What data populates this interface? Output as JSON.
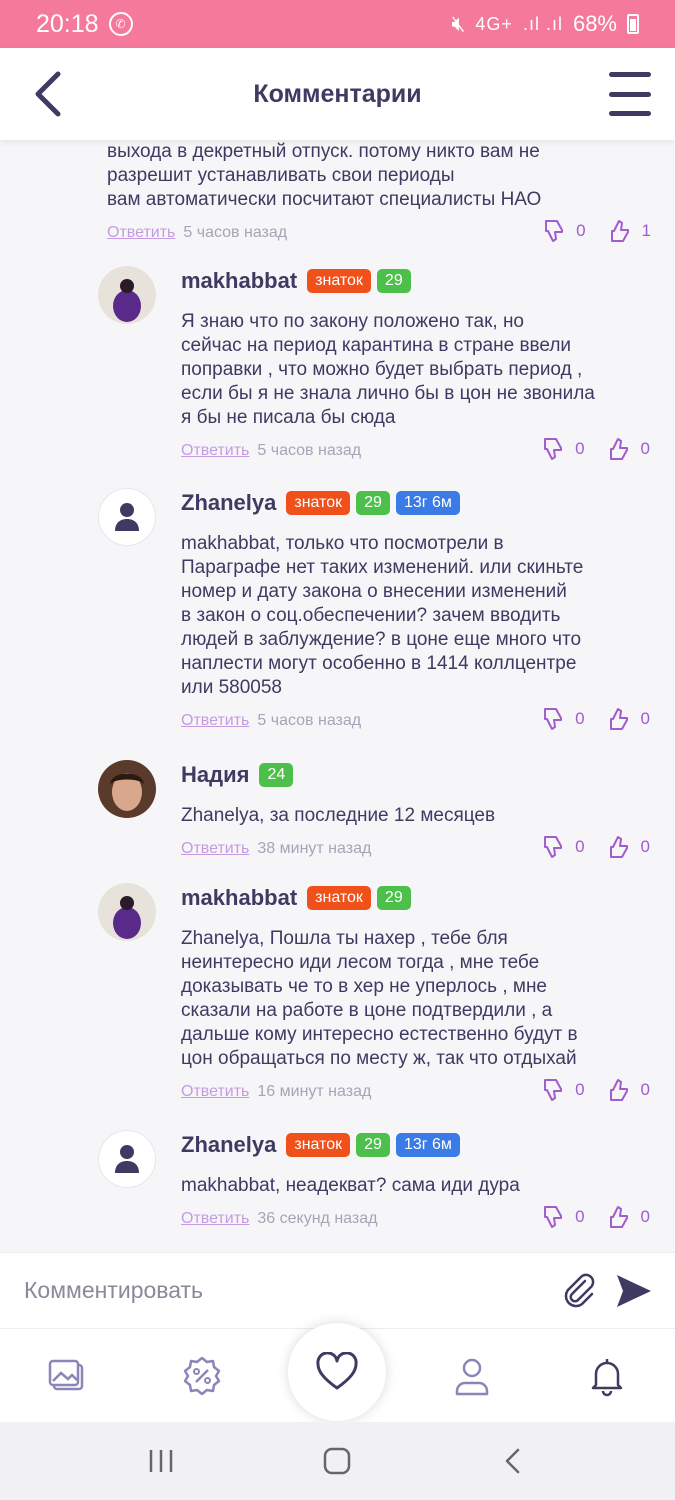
{
  "status_bar": {
    "time": "20:18",
    "network": "4G+",
    "battery": "68%"
  },
  "header": {
    "title": "Комментарии"
  },
  "top_comment": {
    "text": "выхода в декретный отпуск. потому никто вам не\nразрешит устанавливать свои периоды\n вам автоматически посчитают специалисты НАО",
    "reply": "Ответить",
    "time": "5 часов назад",
    "dislikes": "0",
    "likes": "1"
  },
  "comments": [
    {
      "name": "makhabbat",
      "badges": [
        "знаток",
        "29"
      ],
      "text": "Я знаю что по закону положено так, но\nсейчас на период карантина в стране ввели\nпоправки , что можно будет выбрать период ,\nесли бы я не знала лично бы в цон не звонила\nя бы не писала бы сюда",
      "reply": "Ответить",
      "time": "5 часов назад",
      "dislikes": "0",
      "likes": "0"
    },
    {
      "name": "Zhanelya",
      "badges": [
        "знаток",
        "29",
        "13г 6м"
      ],
      "text": "makhabbat, только что посмотрели в\nПараграфе нет таких изменений. или скиньте\nномер и дату закона о внесении изменений\nв закон о соц.обеспечении? зачем вводить\nлюдей в заблуждение? в цоне еще много что\nнаплести могут особенно в 1414 коллцентре\nили 580058",
      "reply": "Ответить",
      "time": "5 часов назад",
      "dislikes": "0",
      "likes": "0"
    },
    {
      "name": "Надия",
      "badges": [
        "24"
      ],
      "text": "Zhanelya, за последние 12 месяцев",
      "reply": "Ответить",
      "time": "38 минут назад",
      "dislikes": "0",
      "likes": "0"
    },
    {
      "name": "makhabbat",
      "badges": [
        "знаток",
        "29"
      ],
      "text": "Zhanelya, Пошла ты нахер , тебе бля\nнеинтересно иди лесом тогда , мне тебе\nдоказывать че то в хер не уперлось , мне\nсказали на работе в цоне подтвердили , а\nдальше кому интересно естественно будут в\nцон обращаться по месту ж, так что отдыхай",
      "reply": "Ответить",
      "time": "16 минут назад",
      "dislikes": "0",
      "likes": "0"
    },
    {
      "name": "Zhanelya",
      "badges": [
        "знаток",
        "29",
        "13г 6м"
      ],
      "text": "makhabbat, неадекват? сама иди дура",
      "reply": "Ответить",
      "time": "36 секунд назад",
      "dislikes": "0",
      "likes": "0"
    }
  ],
  "input": {
    "placeholder": "Комментировать"
  },
  "colors": {
    "status_bar": "#f4799a",
    "accent": "#a05cd0",
    "text": "#3f3a62",
    "badge_expert": "#f0501a",
    "badge_score": "#4cc04a",
    "badge_age": "#3a7be6"
  },
  "icons": {
    "tabs": [
      "gallery-icon",
      "discount-icon",
      "heart-icon",
      "profile-icon",
      "bell-icon"
    ]
  }
}
